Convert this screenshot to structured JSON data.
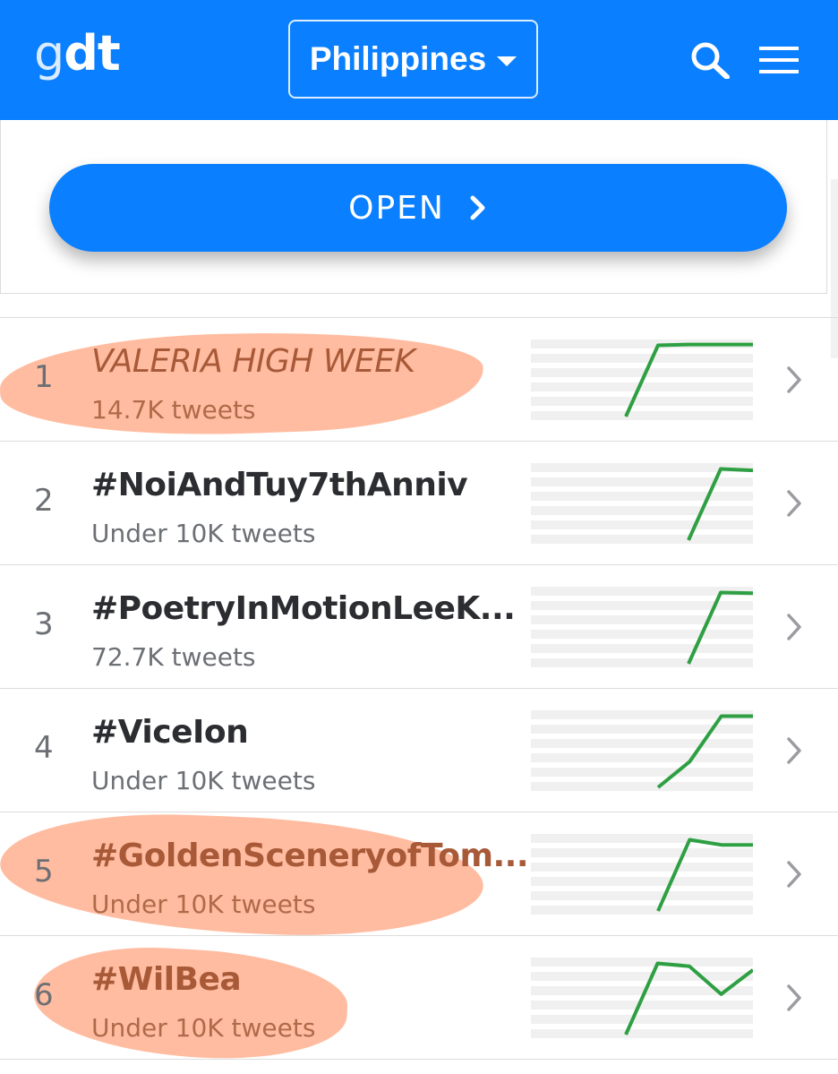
{
  "header": {
    "logo_g": "g",
    "logo_dt": "dt",
    "country": "Philippines",
    "bg_color": "#0a7fff"
  },
  "promo": {
    "open_label": "OPEN"
  },
  "trends": [
    {
      "rank": "1",
      "name": "VALERIA HIGH WEEK",
      "count": "14.7K tweets",
      "highlighted": true,
      "spark": [
        0.0,
        0.97,
        0.98,
        0.98,
        0.98
      ]
    },
    {
      "rank": "2",
      "name": "#NoiAndTuy7thAnniv",
      "count": "Under 10K tweets",
      "highlighted": false,
      "spark": [
        0.0,
        0.97,
        0.95
      ]
    },
    {
      "rank": "3",
      "name": "#PoetryInMotionLeeK...",
      "count": "72.7K tweets",
      "highlighted": false,
      "spark": [
        0.0,
        0.97,
        0.96
      ]
    },
    {
      "rank": "4",
      "name": "#ViceIon",
      "count": "Under 10K tweets",
      "highlighted": false,
      "spark": [
        0.0,
        0.35,
        0.97,
        0.97
      ]
    },
    {
      "rank": "5",
      "name": "#GoldenSceneryofTom...",
      "count": "Under 10K tweets",
      "highlighted": true,
      "spark": [
        0.0,
        0.97,
        0.9,
        0.9
      ]
    },
    {
      "rank": "6",
      "name": "#WilBea",
      "count": "Under 10K tweets",
      "highlighted": true,
      "spark": [
        0.0,
        0.97,
        0.93,
        0.55,
        0.88
      ]
    }
  ],
  "colors": {
    "spark_line": "#2ea043",
    "highlight": "#ffb393",
    "highlight_text": "#a85a38"
  }
}
